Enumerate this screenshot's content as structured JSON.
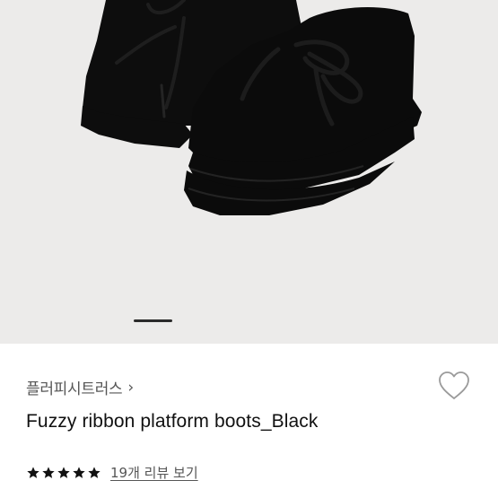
{
  "product": {
    "brand": "플러피시트러스",
    "name": "Fuzzy ribbon platform boots_Black",
    "rating_stars": 5,
    "review_link": "19개 리뷰 보기"
  },
  "gallery": {
    "current_index": 1,
    "image_subject": "boots-photo"
  },
  "icons": {
    "brand_chevron": "chevron-right-icon",
    "wishlist": "heart-outline-icon",
    "star": "star-filled-icon"
  },
  "colors": {
    "background": "#ecebea",
    "text_primary": "#111111",
    "text_secondary": "#555555"
  }
}
